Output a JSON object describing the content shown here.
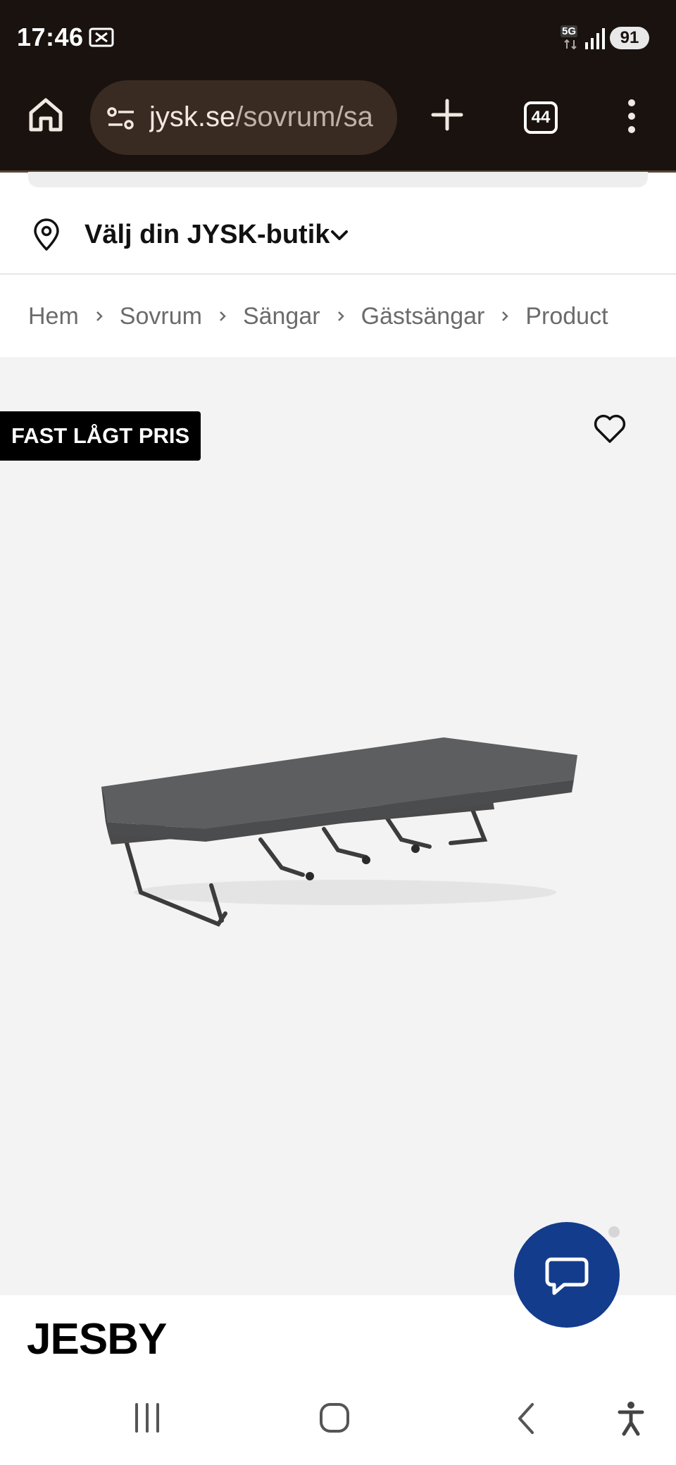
{
  "status_bar": {
    "time": "17:46",
    "network": "5G",
    "battery": "91"
  },
  "browser": {
    "url_domain": "jysk.se",
    "url_path": "/sovrum/sa",
    "tab_count": "44"
  },
  "store_selector": {
    "label": "Välj din JYSK-butik"
  },
  "breadcrumb": {
    "items": [
      "Hem",
      "Sovrum",
      "Sängar",
      "Gästsängar",
      "Product"
    ]
  },
  "product": {
    "badge": "FAST LÅGT PRIS",
    "title": "JESBY"
  },
  "colors": {
    "chrome_bg": "#1a120f",
    "url_pill": "#3a2b22",
    "image_bg": "#f3f3f3",
    "chat_button": "#143c8c",
    "badge_bg": "#000000"
  },
  "icons": [
    "notification-icon",
    "signal-icon",
    "home-icon",
    "tune-icon",
    "plus-icon",
    "more-vert-icon",
    "location-pin-icon",
    "chevron-down-icon",
    "chevron-right-icon",
    "heart-icon",
    "chat-icon",
    "recent-apps-icon",
    "home-circle-icon",
    "back-icon",
    "accessibility-icon"
  ]
}
